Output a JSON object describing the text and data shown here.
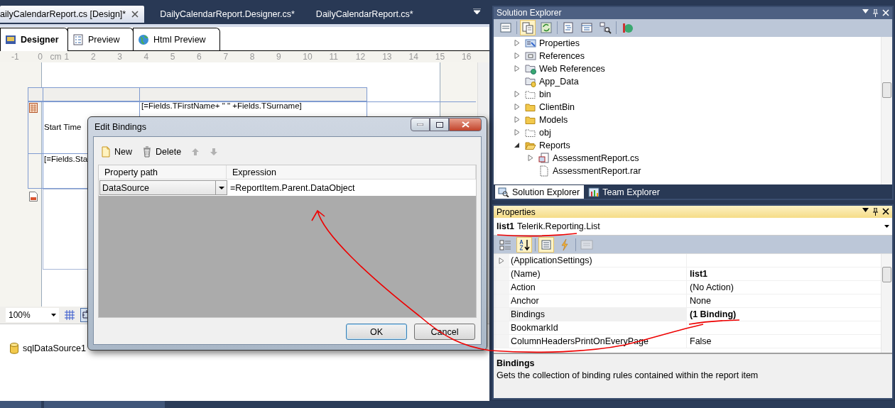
{
  "document_tabs": [
    {
      "label": "ailyCalendarReport.cs [Design]*",
      "selected": true
    },
    {
      "label": "DailyCalendarReport.Designer.cs*",
      "selected": false
    },
    {
      "label": "DailyCalendarReport.cs*",
      "selected": false
    }
  ],
  "view_tabs": [
    {
      "label": "Designer",
      "selected": true,
      "kind": "designer"
    },
    {
      "label": "Preview",
      "selected": false,
      "kind": "preview"
    },
    {
      "label": "Html Preview",
      "selected": false,
      "kind": "html"
    }
  ],
  "ruler": [
    {
      "text": "-1",
      "kind": "number"
    },
    {
      "text": "0",
      "kind": "number"
    },
    {
      "text": "cm",
      "kind": "unit"
    },
    {
      "text": "1",
      "kind": "number"
    },
    {
      "text": "2",
      "kind": "number"
    },
    {
      "text": "3",
      "kind": "number"
    },
    {
      "text": "4",
      "kind": "number"
    },
    {
      "text": "5",
      "kind": "number"
    },
    {
      "text": "6",
      "kind": "number"
    },
    {
      "text": "7",
      "kind": "number"
    },
    {
      "text": "8",
      "kind": "number"
    },
    {
      "text": "9",
      "kind": "number"
    },
    {
      "text": "10",
      "kind": "number"
    },
    {
      "text": "11",
      "kind": "number"
    },
    {
      "text": "12",
      "kind": "number"
    },
    {
      "text": "13",
      "kind": "number"
    },
    {
      "text": "14",
      "kind": "number"
    },
    {
      "text": "15",
      "kind": "number"
    },
    {
      "text": "16",
      "kind": "number"
    }
  ],
  "report": {
    "name_field": "[=Fields.TFirstName+ \" \" +Fields.TSurname]",
    "start_label": "Start Time",
    "start_field": "[=Fields.Sta"
  },
  "zoom_bar": {
    "zoom": "100%"
  },
  "component_tray": [
    {
      "label": "sqlDataSource1",
      "kind": "datasource"
    }
  ],
  "solution_explorer": {
    "title": "Solution Explorer",
    "toolbar": [
      {
        "kind": "properties",
        "selected": false
      },
      {
        "kind": "show-all",
        "selected": true
      },
      {
        "kind": "refresh",
        "selected": false
      },
      {
        "kind": "code",
        "selected": false
      },
      {
        "kind": "designer",
        "selected": false
      },
      {
        "kind": "diagram",
        "selected": false
      },
      {
        "kind": "config",
        "selected": false
      }
    ],
    "tree": [
      {
        "label": "Properties",
        "kind": "properties",
        "expanded": false
      },
      {
        "label": "References",
        "kind": "references",
        "expanded": false
      },
      {
        "label": "Web References",
        "kind": "web",
        "expanded": false
      },
      {
        "label": "App_Data",
        "kind": "data"
      },
      {
        "label": "bin",
        "kind": "hidden-folder",
        "expanded": false
      },
      {
        "label": "ClientBin",
        "kind": "folder",
        "expanded": false
      },
      {
        "label": "Models",
        "kind": "folder",
        "expanded": false
      },
      {
        "label": "obj",
        "kind": "hidden-folder",
        "expanded": false
      },
      {
        "label": "Reports",
        "kind": "folder",
        "expanded": true,
        "children": [
          {
            "label": "AssessmentReport.cs",
            "kind": "report",
            "expanded": false
          },
          {
            "label": "AssessmentReport.rar",
            "kind": "file"
          }
        ]
      }
    ],
    "tabs": [
      {
        "label": "Solution Explorer",
        "selected": true,
        "kind": "solution"
      },
      {
        "label": "Team Explorer",
        "selected": false,
        "kind": "team"
      }
    ]
  },
  "properties": {
    "title": "Properties",
    "object_name": "list1",
    "object_type": "Telerik.Reporting.List",
    "toolbar": [
      {
        "kind": "categorized",
        "selected": false,
        "disabled": false
      },
      {
        "kind": "alphabetical",
        "selected": true,
        "disabled": false
      },
      {
        "kind": "properties",
        "selected": true,
        "disabled": false
      },
      {
        "kind": "events",
        "selected": false,
        "disabled": false
      },
      {
        "kind": "pages",
        "selected": false,
        "disabled": true
      }
    ],
    "rows": [
      {
        "name": "(ApplicationSettings)",
        "expanded": false,
        "selected": false
      },
      {
        "name": "(Name)",
        "value": "list1",
        "modified": true,
        "selected": false
      },
      {
        "name": "Action",
        "value": "(No Action)",
        "modified": false,
        "selected": false
      },
      {
        "name": "Anchor",
        "value": "None",
        "modified": false,
        "selected": false
      },
      {
        "name": "Bindings",
        "value": "(1 Binding)",
        "modified": true,
        "selected": true
      },
      {
        "name": "BookmarkId",
        "selected": false
      },
      {
        "name": "ColumnHeadersPrintOnEveryPage",
        "value": "False",
        "modified": false,
        "selected": false
      }
    ],
    "description": {
      "title": "Bindings",
      "text": "Gets the collection of binding rules contained within the report item"
    }
  },
  "dialog": {
    "title": "Edit Bindings",
    "toolbar": [
      {
        "kind": "new",
        "label": "New",
        "disabled": false
      },
      {
        "kind": "delete",
        "label": "Delete",
        "disabled": false
      },
      {
        "kind": "up",
        "disabled": true
      },
      {
        "kind": "down",
        "disabled": true
      }
    ],
    "columns": [
      "Property path",
      "Expression"
    ],
    "rows": [
      {
        "property": "DataSource",
        "expression": "=ReportItem.Parent.DataObject"
      }
    ],
    "buttons": [
      {
        "label": "OK",
        "default": true
      },
      {
        "label": "Cancel",
        "default": false
      }
    ]
  }
}
